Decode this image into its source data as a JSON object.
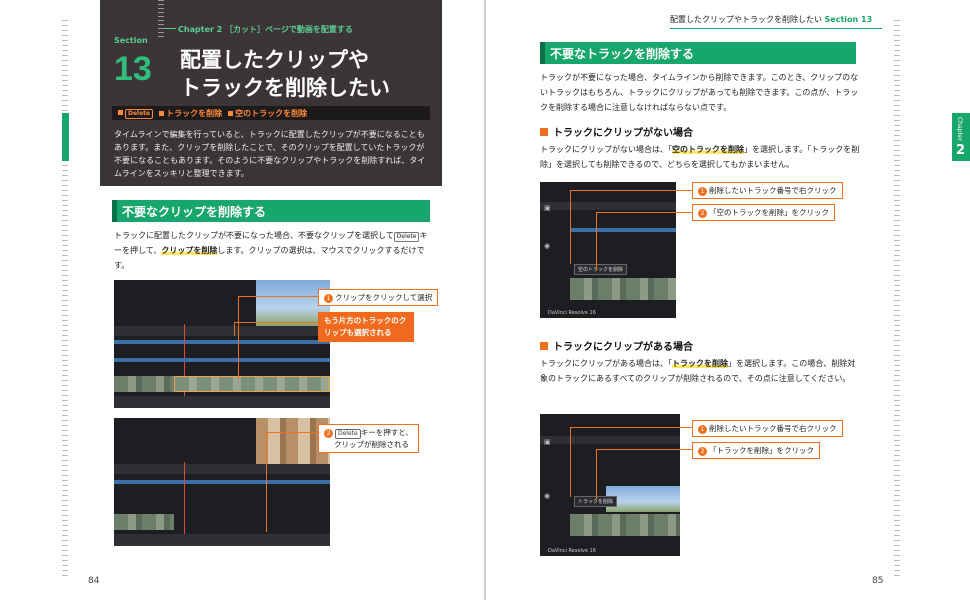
{
  "left_page": {
    "chapter_line": "Chapter 2 ［カット］ページで動画を配置する",
    "section_label": "Section",
    "section_number": "13",
    "title_line1": "配置したクリップや",
    "title_line2": "トラックを削除したい",
    "tags": {
      "key": "Delete",
      "tag1": "トラックを削除",
      "tag2": "空のトラックを削除"
    },
    "intro": "タイムラインで編集を行っていると、トラックに配置したクリップが不要になることもあります。また、クリップを削除したことで、そのクリップを配置していたトラックが不要になることもあります。そのように不要なクリップやトラックを削除すれば、タイムラインをスッキリと整理できます。",
    "heading": "不要なクリップを削除する",
    "body_pre": "トラックに配置したクリップが不要になった場合、不要なクリップを選択して",
    "body_key": "Delete",
    "body_mid": "キーを押して、",
    "body_hl": "クリップを削除",
    "body_post": "します。クリップの選択は、マウスでクリックするだけです。",
    "callout1_num": "1",
    "callout1": "クリップをクリックして選択",
    "callout_note": "もう片方のトラックのクリップも選択される",
    "callout2_num": "2",
    "callout2_key": "Delete",
    "callout2_a": "キーを押すと、",
    "callout2_b": "クリップが削除される",
    "page_number": "84"
  },
  "right_page": {
    "running_head": "配置したクリップやトラックを削除したい",
    "running_section": "Section 13",
    "chapter_tab_label": "Chapter",
    "chapter_tab_number": "2",
    "heading": "不要なトラックを削除する",
    "body": "トラックが不要になった場合、タイムラインから削除できます。このとき、クリップのないトラックはもちろん、トラックにクリップがあっても削除できます。この点が、トラックを削除する場合に注意しなければならない点です。",
    "sub1": {
      "title": "トラックにクリップがない場合",
      "pre": "トラックにクリップがない場合は、「",
      "hl": "空のトラックを削除",
      "post": "」を選択します。「トラックを削除」を選択しても削除できるので、どちらを選択してもかまいません。",
      "callout1_num": "1",
      "callout1": "削除したいトラック番号で右クリック",
      "callout2_num": "2",
      "callout2": "「空のトラックを削除」をクリック",
      "menu_text": "空のトラックを削除"
    },
    "sub2": {
      "title": "トラックにクリップがある場合",
      "pre": "トラックにクリップがある場合は、「",
      "hl": "トラックを削除",
      "post": "」を選択します。この場合、削除対象のトラックにあるすべてのクリップが削除されるので、その点に注意してください。",
      "callout1_num": "1",
      "callout1": "削除したいトラック番号で右クリック",
      "callout2_num": "2",
      "callout2": "「トラックを削除」をクリック",
      "menu_text": "トラックを削除"
    },
    "brand": "DaVinci Resolve 16",
    "page_number": "85"
  },
  "colors": {
    "accent_green": "#17a66c",
    "accent_orange": "#f07020",
    "header_dark": "#3b3537"
  }
}
